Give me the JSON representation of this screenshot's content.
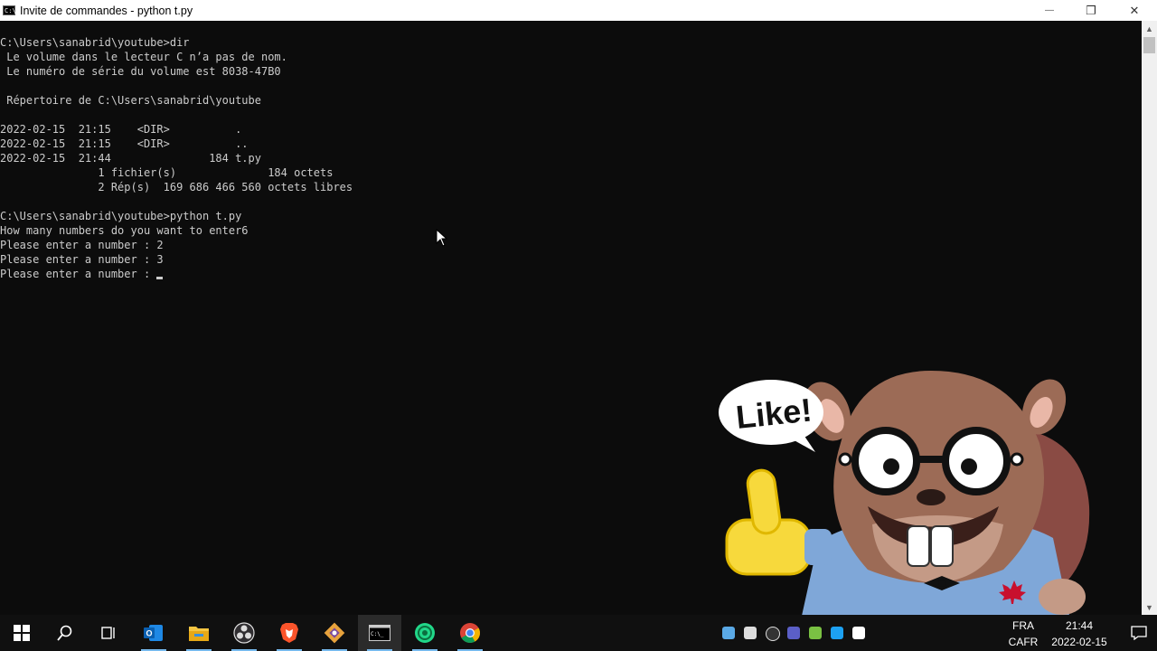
{
  "window": {
    "title": "Invite de commandes - python  t.py",
    "minimize_glyph": "—",
    "restore_glyph": "❐",
    "close_glyph": "✕"
  },
  "console": {
    "lines": [
      "C:\\Users\\sanabrid\\youtube>dir",
      " Le volume dans le lecteur C n’a pas de nom.",
      " Le numéro de série du volume est 8038-47B0",
      "",
      " Répertoire de C:\\Users\\sanabrid\\youtube",
      "",
      "2022-02-15  21:15    <DIR>          .",
      "2022-02-15  21:15    <DIR>          ..",
      "2022-02-15  21:44               184 t.py",
      "               1 fichier(s)              184 octets",
      "               2 Rép(s)  169 686 466 560 octets libres",
      "",
      "C:\\Users\\sanabrid\\youtube>python t.py",
      "How many numbers do you want to enter6",
      "Please enter a number : 2",
      "Please enter a number : 3",
      "Please enter a number : "
    ]
  },
  "overlay": {
    "speech_bubble": "Like!"
  },
  "taskbar": {
    "icons": [
      "windows-start-icon",
      "search-icon",
      "task-view-icon",
      "outlook-icon",
      "file-explorer-icon",
      "obs-icon",
      "brave-browser-icon",
      "git-icon",
      "command-prompt-icon",
      "pycharm-icon",
      "chrome-icon"
    ],
    "language": {
      "line1": "FRA",
      "line2": "CAFR"
    },
    "clock": {
      "time": "21:44",
      "date": "2022-02-15"
    }
  },
  "colors": {
    "console_bg": "#0c0c0c",
    "console_text": "#cccccc",
    "taskbar_bg": "#101010",
    "accent": "#76b9ed"
  }
}
